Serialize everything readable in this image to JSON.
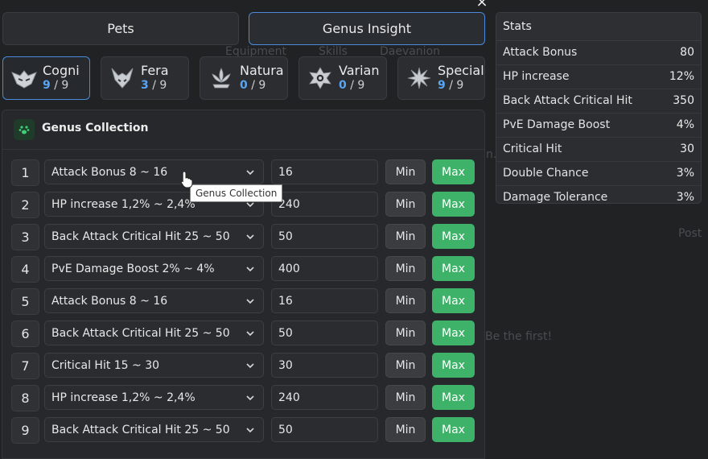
{
  "window": {
    "close_glyph": "×"
  },
  "background": {
    "nav": [
      "Equipment",
      "Skills",
      "Daevanion"
    ],
    "fragment_1": "n.",
    "fragment_2": "Post",
    "fragment_3": "Be the first!"
  },
  "tabs": [
    {
      "label": "Pets",
      "active": false
    },
    {
      "label": "Genus Insight",
      "active": true
    }
  ],
  "genus": [
    {
      "name": "Cogni",
      "count": "9",
      "total": "9",
      "icon": "cogni-icon",
      "active": true
    },
    {
      "name": "Fera",
      "count": "3",
      "total": "9",
      "icon": "fera-icon",
      "active": false
    },
    {
      "name": "Natura",
      "count": "0",
      "total": "9",
      "icon": "natura-icon",
      "active": false
    },
    {
      "name": "Varian",
      "count": "0",
      "total": "9",
      "icon": "varian-icon",
      "active": false
    },
    {
      "name": "Special",
      "count": "9",
      "total": "9",
      "icon": "special-icon",
      "active": false
    }
  ],
  "collection": {
    "title": "Genus Collection",
    "icon": "paw-icon",
    "min_label": "Min",
    "max_label": "Max",
    "rows": [
      {
        "index": "1",
        "option": "Attack Bonus 8 ~ 16",
        "value": "16"
      },
      {
        "index": "2",
        "option": "HP increase 1,2% ~ 2,4%",
        "value": "240"
      },
      {
        "index": "3",
        "option": "Back Attack Critical Hit 25 ~ 50",
        "value": "50"
      },
      {
        "index": "4",
        "option": "PvE Damage Boost 2% ~ 4%",
        "value": "400"
      },
      {
        "index": "5",
        "option": "Attack Bonus 8 ~ 16",
        "value": "16"
      },
      {
        "index": "6",
        "option": "Back Attack Critical Hit 25 ~ 50",
        "value": "50"
      },
      {
        "index": "7",
        "option": "Critical Hit 15 ~ 30",
        "value": "30"
      },
      {
        "index": "8",
        "option": "HP increase 1,2% ~ 2,4%",
        "value": "240"
      },
      {
        "index": "9",
        "option": "Back Attack Critical Hit 25 ~ 50",
        "value": "50"
      }
    ]
  },
  "tooltip": {
    "text": "Genus Collection"
  },
  "stats": {
    "title": "Stats",
    "rows": [
      {
        "label": "Attack Bonus",
        "value": "80"
      },
      {
        "label": "HP increase",
        "value": "12%"
      },
      {
        "label": "Back Attack Critical Hit",
        "value": "350"
      },
      {
        "label": "PvE Damage Boost",
        "value": "4%"
      },
      {
        "label": "Critical Hit",
        "value": "30"
      },
      {
        "label": "Double Chance",
        "value": "3%"
      },
      {
        "label": "Damage Tolerance",
        "value": "3%"
      }
    ]
  },
  "colors": {
    "accent_blue": "#4a8ad8",
    "count_blue": "#5aa5f2",
    "max_green": "#3fb26a",
    "background": "#202224"
  }
}
